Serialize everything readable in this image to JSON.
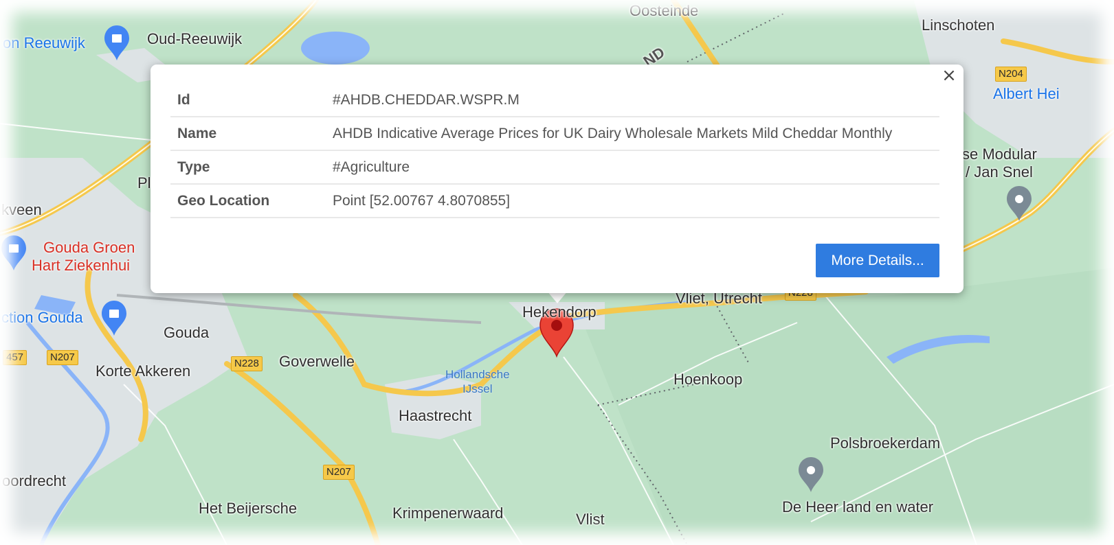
{
  "popup": {
    "close_glyph": "×",
    "rows": [
      {
        "key": "Id",
        "value": "#AHDB.CHEDDAR.WSPR.M"
      },
      {
        "key": "Name",
        "value": "AHDB Indicative Average Prices for UK Dairy Wholesale Markets Mild Cheddar Monthly"
      },
      {
        "key": "Type",
        "value": "#Agriculture"
      },
      {
        "key": "Geo Location",
        "value": "Point [52.00767 4.8070855]"
      }
    ],
    "more_button": "More Details..."
  },
  "map": {
    "colors": {
      "land": "#bfe2c8",
      "urban": "#dde3e5",
      "road": "#f5c84c",
      "marker": "#ea4335",
      "water": "#8ab4f8"
    },
    "places": {
      "oosteinde": "Oosteinde",
      "linschoten": "Linschoten",
      "oud_reeuwijk": "Oud-Reeuwijk",
      "reeuwijk": "on Reeuwijk",
      "albert_heijn": "Albert Hei",
      "modular": "se Modular",
      "jan_snel": "/ Jan Snel",
      "kveen": "kveen",
      "pl": "Pl",
      "gouda_groen": "Gouda Groen",
      "hart_ziekenhuis": "Hart Ziekenhui",
      "ction_gouda": "ction Gouda",
      "gouda": "Gouda",
      "korte_akkeren": "Korte Akkeren",
      "goverwelle": "Goverwelle",
      "hekendorp": "Hekendorp",
      "vliet_utrecht": "Vliet, Utrecht",
      "hoenkoop": "Hoenkoop",
      "hollandsche_ijssel": "Hollandsche\nIJssel",
      "haastrecht": "Haastrecht",
      "polsbroekerdam": "Polsbroekerdam",
      "oordrecht": "oordrecht",
      "het_beijersche": "Het Beijersche",
      "krimpenerwaard": "Krimpenerwaard",
      "vlist": "Vlist",
      "de_heer": "De Heer land en water",
      "nd": "ND"
    },
    "roads": {
      "n204": "N204",
      "n207a": "N207",
      "n207b": "N207",
      "n228a": "N228",
      "n228b": "N228",
      "n457": "457"
    },
    "icons": [
      "shopping-bag-icon",
      "location-pin-icon",
      "map-marker-icon"
    ]
  }
}
